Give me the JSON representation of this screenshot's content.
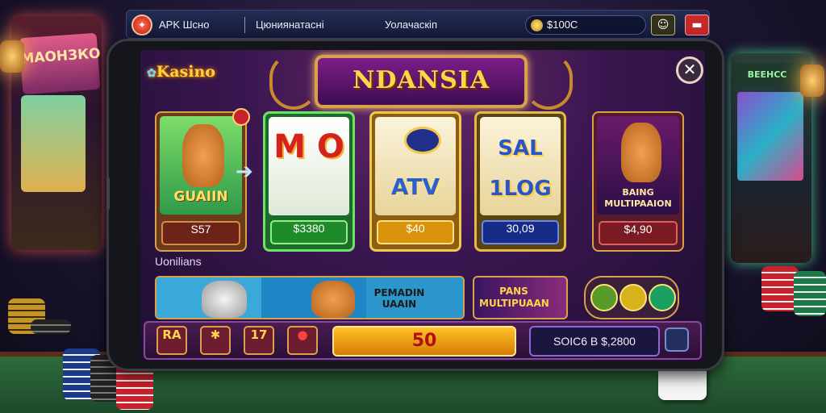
{
  "topbar": {
    "app_name": "APK Шсно",
    "user": "Цюниянатасні",
    "nav_label": "Уолачаскіп",
    "balance": "$100C"
  },
  "screen": {
    "brand": "Kasino",
    "banner_title": "NDANSIA",
    "close_label": "✕"
  },
  "cards": [
    {
      "title": "GUAIIN",
      "price": "S57",
      "accent": "#6fe06a"
    },
    {
      "title": "M O",
      "price": "$3380",
      "accent": "#6fe06a"
    },
    {
      "title": "ATV",
      "price": "$40",
      "accent": "#ffe07a"
    },
    {
      "title": "SAL 1LOG",
      "price": "30,09",
      "accent": "#6a8af0"
    },
    {
      "title": "BAING MULTIPAAION",
      "price": "$4,90",
      "accent": "#e06060"
    }
  ],
  "section": {
    "label": "Uonilians",
    "strip_title": "PEMADIN UAAIN",
    "game_title": "PANS MULTIPUAAN"
  },
  "bottom": {
    "buttons": [
      "RA",
      "✱",
      "17",
      "●"
    ],
    "spin_label": "50",
    "total": "SOIC6 B $,2800"
  },
  "icons": {
    "top_logo": "fox-icon",
    "user": "user-icon",
    "flag": "flag-icon",
    "coin": "coin-icon",
    "close": "close-icon",
    "arrow": "arrow-right-icon"
  },
  "colors": {
    "accent_gold": "#d9a24a",
    "banner_purple": "#7c1d88",
    "spin_orange": "#ffc22a"
  }
}
